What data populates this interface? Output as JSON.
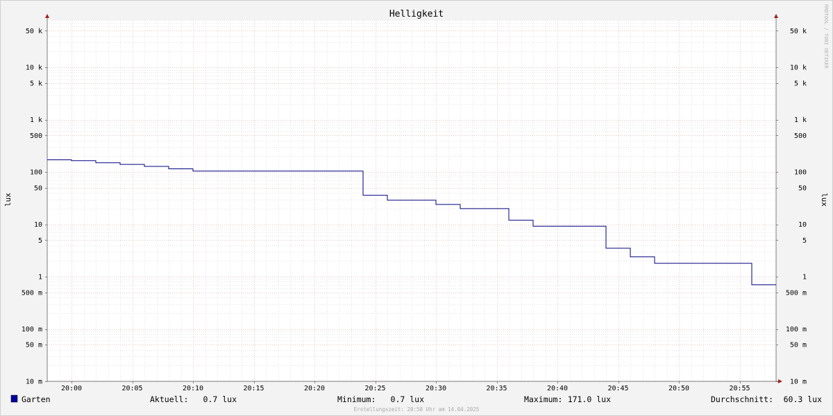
{
  "chart_data": {
    "type": "line",
    "title": "Helligkeit",
    "ylabel": "lux",
    "yscale": "log",
    "ylim": [
      0.01,
      80000
    ],
    "y_ticks": [
      {
        "value": 50000,
        "label": "50 k"
      },
      {
        "value": 10000,
        "label": "10 k"
      },
      {
        "value": 5000,
        "label": "5 k"
      },
      {
        "value": 1000,
        "label": "1 k"
      },
      {
        "value": 500,
        "label": "500"
      },
      {
        "value": 100,
        "label": "100"
      },
      {
        "value": 50,
        "label": "50"
      },
      {
        "value": 10,
        "label": "10"
      },
      {
        "value": 5,
        "label": "5"
      },
      {
        "value": 1,
        "label": "1"
      },
      {
        "value": 0.5,
        "label": "500 m"
      },
      {
        "value": 0.1,
        "label": "100 m"
      },
      {
        "value": 0.05,
        "label": "50 m"
      },
      {
        "value": 0.01,
        "label": "10 m"
      }
    ],
    "x_ticks": [
      "20:00",
      "20:05",
      "20:10",
      "20:15",
      "20:20",
      "20:25",
      "20:30",
      "20:35",
      "20:40",
      "20:45",
      "20:50",
      "20:55"
    ],
    "xlim": [
      "19:58",
      "20:58"
    ],
    "grid": true,
    "series": [
      {
        "name": "Garten",
        "color": "#000080",
        "points": [
          {
            "t": "19:58",
            "v": 171.0
          },
          {
            "t": "20:00",
            "v": 165
          },
          {
            "t": "20:02",
            "v": 150
          },
          {
            "t": "20:04",
            "v": 140
          },
          {
            "t": "20:06",
            "v": 128
          },
          {
            "t": "20:08",
            "v": 115
          },
          {
            "t": "20:10",
            "v": 104
          },
          {
            "t": "20:24",
            "v": 36
          },
          {
            "t": "20:26",
            "v": 29
          },
          {
            "t": "20:30",
            "v": 24
          },
          {
            "t": "20:32",
            "v": 20
          },
          {
            "t": "20:36",
            "v": 12
          },
          {
            "t": "20:38",
            "v": 9.2
          },
          {
            "t": "20:44",
            "v": 3.5
          },
          {
            "t": "20:46",
            "v": 2.4
          },
          {
            "t": "20:48",
            "v": 1.8
          },
          {
            "t": "20:56",
            "v": 0.7
          },
          {
            "t": "20:58",
            "v": 0.7
          }
        ]
      }
    ]
  },
  "watermark": "RRDTOOL / TOBI OETIKER",
  "legend": {
    "series_name": "Garten",
    "swatch_color": "#0000a0",
    "stats": [
      {
        "label": "Aktuell:",
        "value": "0.7 lux"
      },
      {
        "label": "Minimum:",
        "value": "0.7 lux"
      },
      {
        "label": "Maximum:",
        "value": "171.0 lux"
      },
      {
        "label": "Durchschnitt:",
        "value": "60.3 lux"
      }
    ]
  },
  "footer": "Erstellungszeit: 20:58 Uhr am 14.04.2025",
  "colors": {
    "background": "#f3f3f3",
    "plot_background": "#ffffff",
    "minor_grid": "#c8c8c8",
    "major_grid": "#e6a0a0",
    "axis": "#808080",
    "arrow": "#a02020"
  }
}
